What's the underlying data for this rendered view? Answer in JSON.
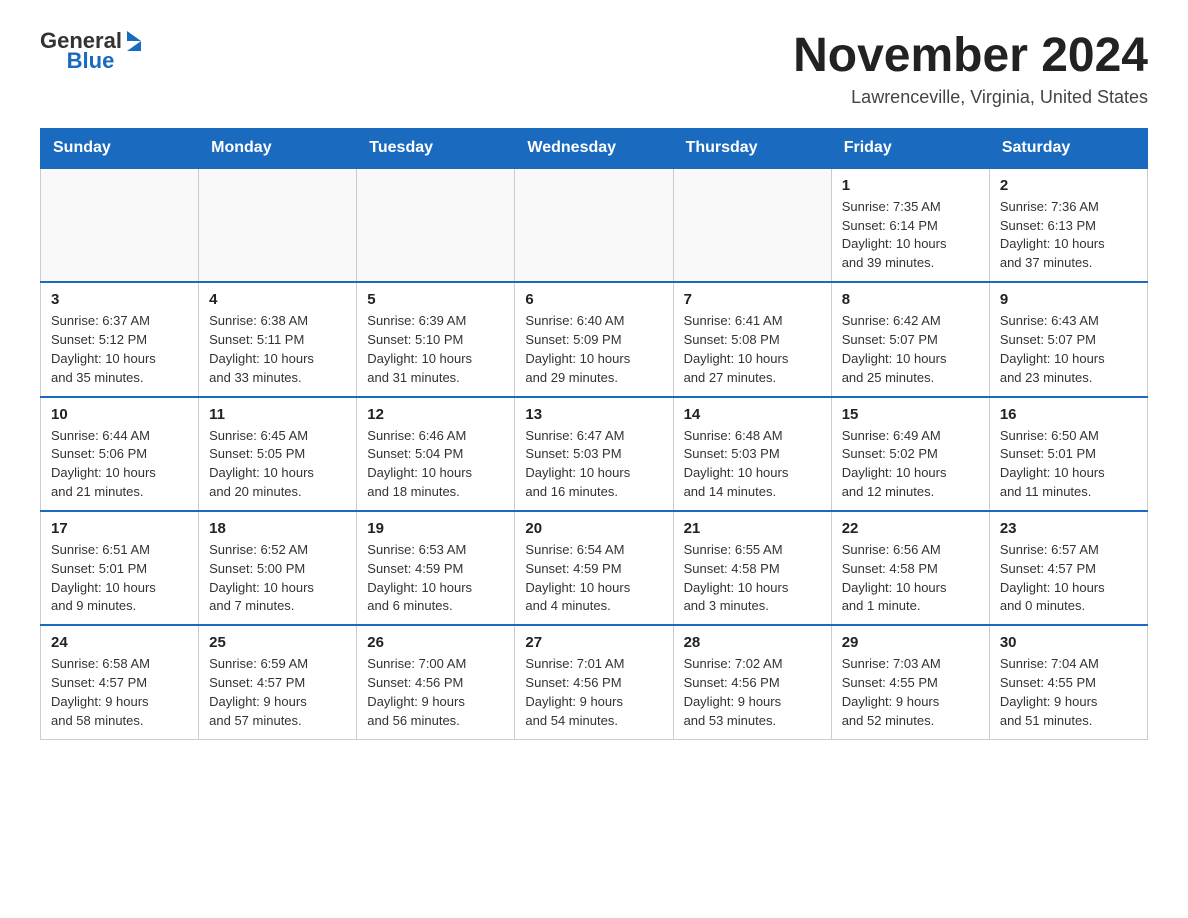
{
  "header": {
    "logo_general": "General",
    "logo_blue": "Blue",
    "month_title": "November 2024",
    "location": "Lawrenceville, Virginia, United States"
  },
  "days_of_week": [
    "Sunday",
    "Monday",
    "Tuesday",
    "Wednesday",
    "Thursday",
    "Friday",
    "Saturday"
  ],
  "weeks": [
    {
      "days": [
        {
          "number": "",
          "info": "",
          "empty": true
        },
        {
          "number": "",
          "info": "",
          "empty": true
        },
        {
          "number": "",
          "info": "",
          "empty": true
        },
        {
          "number": "",
          "info": "",
          "empty": true
        },
        {
          "number": "",
          "info": "",
          "empty": true
        },
        {
          "number": "1",
          "info": "Sunrise: 7:35 AM\nSunset: 6:14 PM\nDaylight: 10 hours\nand 39 minutes."
        },
        {
          "number": "2",
          "info": "Sunrise: 7:36 AM\nSunset: 6:13 PM\nDaylight: 10 hours\nand 37 minutes."
        }
      ]
    },
    {
      "days": [
        {
          "number": "3",
          "info": "Sunrise: 6:37 AM\nSunset: 5:12 PM\nDaylight: 10 hours\nand 35 minutes."
        },
        {
          "number": "4",
          "info": "Sunrise: 6:38 AM\nSunset: 5:11 PM\nDaylight: 10 hours\nand 33 minutes."
        },
        {
          "number": "5",
          "info": "Sunrise: 6:39 AM\nSunset: 5:10 PM\nDaylight: 10 hours\nand 31 minutes."
        },
        {
          "number": "6",
          "info": "Sunrise: 6:40 AM\nSunset: 5:09 PM\nDaylight: 10 hours\nand 29 minutes."
        },
        {
          "number": "7",
          "info": "Sunrise: 6:41 AM\nSunset: 5:08 PM\nDaylight: 10 hours\nand 27 minutes."
        },
        {
          "number": "8",
          "info": "Sunrise: 6:42 AM\nSunset: 5:07 PM\nDaylight: 10 hours\nand 25 minutes."
        },
        {
          "number": "9",
          "info": "Sunrise: 6:43 AM\nSunset: 5:07 PM\nDaylight: 10 hours\nand 23 minutes."
        }
      ]
    },
    {
      "days": [
        {
          "number": "10",
          "info": "Sunrise: 6:44 AM\nSunset: 5:06 PM\nDaylight: 10 hours\nand 21 minutes."
        },
        {
          "number": "11",
          "info": "Sunrise: 6:45 AM\nSunset: 5:05 PM\nDaylight: 10 hours\nand 20 minutes."
        },
        {
          "number": "12",
          "info": "Sunrise: 6:46 AM\nSunset: 5:04 PM\nDaylight: 10 hours\nand 18 minutes."
        },
        {
          "number": "13",
          "info": "Sunrise: 6:47 AM\nSunset: 5:03 PM\nDaylight: 10 hours\nand 16 minutes."
        },
        {
          "number": "14",
          "info": "Sunrise: 6:48 AM\nSunset: 5:03 PM\nDaylight: 10 hours\nand 14 minutes."
        },
        {
          "number": "15",
          "info": "Sunrise: 6:49 AM\nSunset: 5:02 PM\nDaylight: 10 hours\nand 12 minutes."
        },
        {
          "number": "16",
          "info": "Sunrise: 6:50 AM\nSunset: 5:01 PM\nDaylight: 10 hours\nand 11 minutes."
        }
      ]
    },
    {
      "days": [
        {
          "number": "17",
          "info": "Sunrise: 6:51 AM\nSunset: 5:01 PM\nDaylight: 10 hours\nand 9 minutes."
        },
        {
          "number": "18",
          "info": "Sunrise: 6:52 AM\nSunset: 5:00 PM\nDaylight: 10 hours\nand 7 minutes."
        },
        {
          "number": "19",
          "info": "Sunrise: 6:53 AM\nSunset: 4:59 PM\nDaylight: 10 hours\nand 6 minutes."
        },
        {
          "number": "20",
          "info": "Sunrise: 6:54 AM\nSunset: 4:59 PM\nDaylight: 10 hours\nand 4 minutes."
        },
        {
          "number": "21",
          "info": "Sunrise: 6:55 AM\nSunset: 4:58 PM\nDaylight: 10 hours\nand 3 minutes."
        },
        {
          "number": "22",
          "info": "Sunrise: 6:56 AM\nSunset: 4:58 PM\nDaylight: 10 hours\nand 1 minute."
        },
        {
          "number": "23",
          "info": "Sunrise: 6:57 AM\nSunset: 4:57 PM\nDaylight: 10 hours\nand 0 minutes."
        }
      ]
    },
    {
      "days": [
        {
          "number": "24",
          "info": "Sunrise: 6:58 AM\nSunset: 4:57 PM\nDaylight: 9 hours\nand 58 minutes."
        },
        {
          "number": "25",
          "info": "Sunrise: 6:59 AM\nSunset: 4:57 PM\nDaylight: 9 hours\nand 57 minutes."
        },
        {
          "number": "26",
          "info": "Sunrise: 7:00 AM\nSunset: 4:56 PM\nDaylight: 9 hours\nand 56 minutes."
        },
        {
          "number": "27",
          "info": "Sunrise: 7:01 AM\nSunset: 4:56 PM\nDaylight: 9 hours\nand 54 minutes."
        },
        {
          "number": "28",
          "info": "Sunrise: 7:02 AM\nSunset: 4:56 PM\nDaylight: 9 hours\nand 53 minutes."
        },
        {
          "number": "29",
          "info": "Sunrise: 7:03 AM\nSunset: 4:55 PM\nDaylight: 9 hours\nand 52 minutes."
        },
        {
          "number": "30",
          "info": "Sunrise: 7:04 AM\nSunset: 4:55 PM\nDaylight: 9 hours\nand 51 minutes."
        }
      ]
    }
  ]
}
